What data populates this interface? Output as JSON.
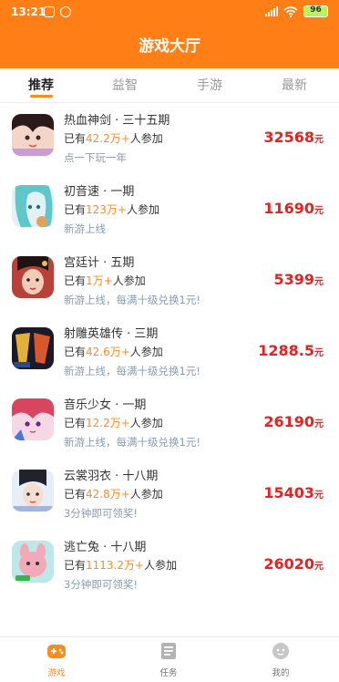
{
  "status_bar": {
    "time": "13:21",
    "battery": "96",
    "colors": {
      "background": "#ff7f16"
    }
  },
  "header": {
    "title": "游戏大厅"
  },
  "tabs": [
    {
      "label": "推荐",
      "active": true
    },
    {
      "label": "益智",
      "active": false
    },
    {
      "label": "手游",
      "active": false
    },
    {
      "label": "最新",
      "active": false
    }
  ],
  "games": [
    {
      "name": "热血神剑 · 三十五期",
      "players_prefix": "已有",
      "players_count": "42.2万+",
      "players_suffix": "人参加",
      "desc": "点一下玩一年",
      "prize": "32568",
      "prize_unit": "元",
      "icon": "game-avatar-icon"
    },
    {
      "name": "初音速 · 一期",
      "players_prefix": "已有",
      "players_count": "123万+",
      "players_suffix": "人参加",
      "desc": "新游上线",
      "prize": "11690",
      "prize_unit": "元",
      "icon": "game-avatar-icon"
    },
    {
      "name": "宫廷计 · 五期",
      "players_prefix": "已有",
      "players_count": "1万+",
      "players_suffix": "人参加",
      "desc": "新游上线，每满十级兑换1元!",
      "prize": "5399",
      "prize_unit": "元",
      "icon": "game-avatar-icon"
    },
    {
      "name": "射雕英雄传 · 三期",
      "players_prefix": "已有",
      "players_count": "42.6万+",
      "players_suffix": "人参加",
      "desc": "新游上线，每满十级兑换1元!",
      "prize": "1288.5",
      "prize_unit": "元",
      "icon": "game-avatar-icon"
    },
    {
      "name": "音乐少女 · 一期",
      "players_prefix": "已有",
      "players_count": "12.2万+",
      "players_suffix": "人参加",
      "desc": "新游上线，每满十级兑换1元!",
      "prize": "26190",
      "prize_unit": "元",
      "icon": "game-avatar-icon"
    },
    {
      "name": "云裳羽衣 · 十八期",
      "players_prefix": "已有",
      "players_count": "42.8万+",
      "players_suffix": "人参加",
      "desc": "3分钟即可领奖!",
      "prize": "15403",
      "prize_unit": "元",
      "icon": "game-avatar-icon"
    },
    {
      "name": "逃亡兔 · 十八期",
      "players_prefix": "已有",
      "players_count": "1113.2万+",
      "players_suffix": "人参加",
      "desc": "3分钟即可领奖!",
      "prize": "26020",
      "prize_unit": "元",
      "icon": "game-avatar-icon"
    }
  ],
  "bottom_nav": [
    {
      "label": "游戏",
      "icon": "gamepad-icon",
      "active": true
    },
    {
      "label": "任务",
      "icon": "task-list-icon",
      "active": false
    },
    {
      "label": "我的",
      "icon": "profile-icon",
      "active": false
    }
  ],
  "colors": {
    "accent": "#ff8a1e",
    "prize": "#e52222",
    "desc": "#8a9bb0"
  }
}
